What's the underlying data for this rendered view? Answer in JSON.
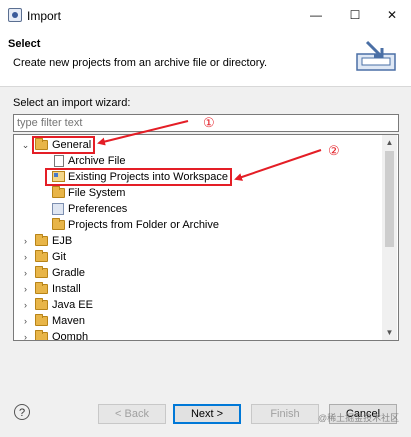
{
  "window": {
    "title": "Import",
    "minimize": "—",
    "maximize": "☐",
    "close": "✕"
  },
  "banner": {
    "title": "Select",
    "description": "Create new projects from an archive file or directory."
  },
  "wizard": {
    "label": "Select an import wizard:",
    "filter_placeholder": "type filter text"
  },
  "tree": {
    "general": "General",
    "general_children": [
      "Archive File",
      "Existing Projects into Workspace",
      "File System",
      "Preferences",
      "Projects from Folder or Archive"
    ],
    "categories": [
      "EJB",
      "Git",
      "Gradle",
      "Install",
      "Java EE",
      "Maven",
      "Oomph"
    ]
  },
  "annotations": {
    "one": "①",
    "two": "②"
  },
  "buttons": {
    "help": "?",
    "back": "< Back",
    "next": "Next >",
    "finish": "Finish",
    "cancel": "Cancel"
  },
  "watermark": "@稀土掘金技术社区",
  "colors": {
    "highlight": "#e41e26",
    "default_button_border": "#0078d7"
  }
}
